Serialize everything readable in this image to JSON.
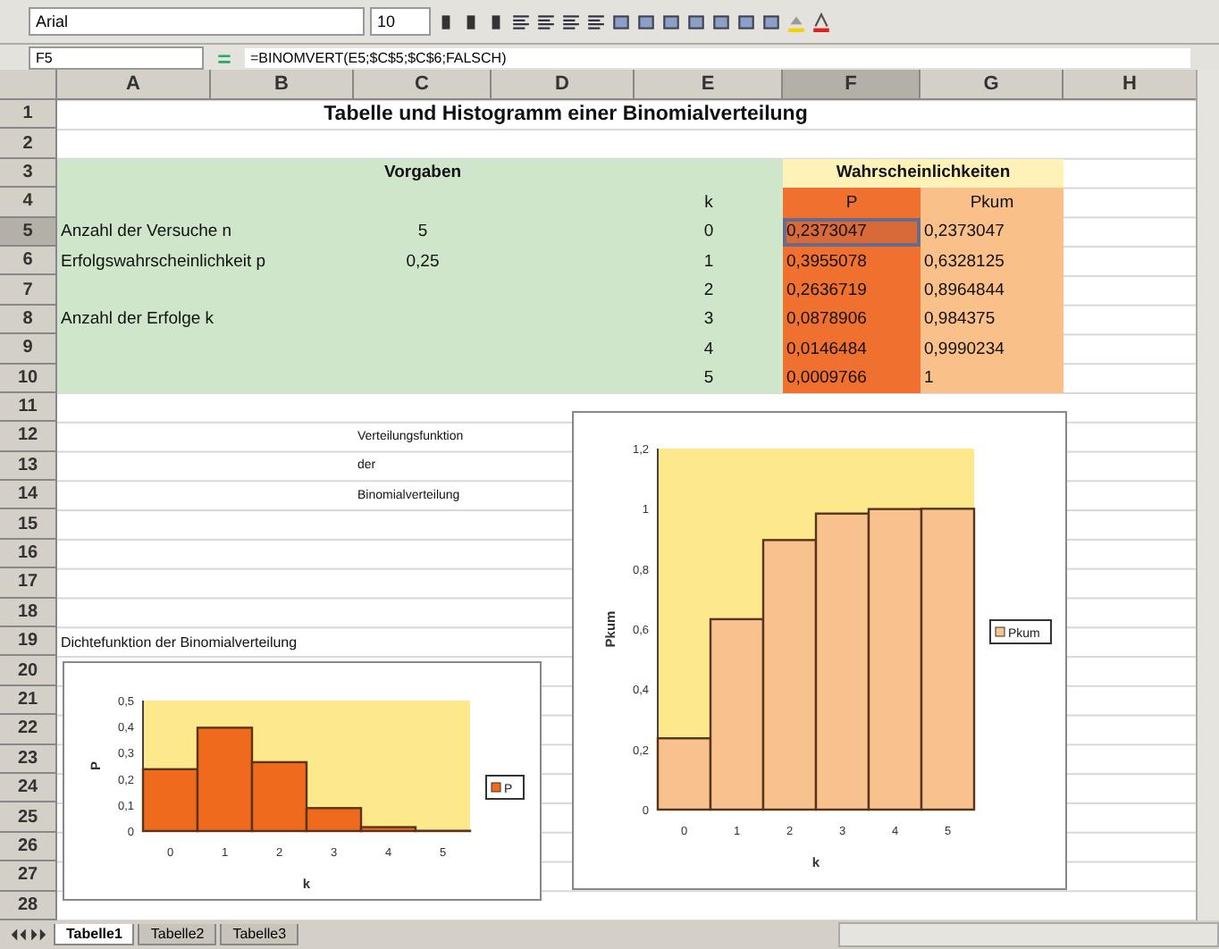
{
  "toolbar": {
    "font": "Arial",
    "size": "10"
  },
  "formula_bar": {
    "name_box": "F5",
    "formula": "=BINOMVERT(E5;$C$5;$C$6;FALSCH)"
  },
  "columns": [
    "A",
    "B",
    "C",
    "D",
    "E",
    "F",
    "G",
    "H"
  ],
  "rows": [
    "1",
    "2",
    "3",
    "4",
    "5",
    "6",
    "7",
    "8",
    "9",
    "10",
    "11",
    "12",
    "13",
    "14",
    "15",
    "16",
    "17",
    "18",
    "19",
    "20",
    "21",
    "22",
    "23",
    "24",
    "25",
    "26",
    "27",
    "28"
  ],
  "title": "Tabelle und Histogramm einer Binomialverteilung",
  "inputs": {
    "heading": "Vorgaben",
    "params": [
      {
        "label": "Anzahl der Versuche n",
        "value": "5"
      },
      {
        "label": "Erfolgswahrscheinlichkeit p",
        "value": "0,25"
      },
      {
        "label": "Anzahl der Erfolge k"
      }
    ]
  },
  "probabilities": {
    "heading": "Wahrscheinlichkeiten",
    "k_header": "k",
    "p_header": "P",
    "pkum_header": "Pkum",
    "rows": [
      {
        "k": "0",
        "p": "0,2373047",
        "pkum": "0,2373047",
        "selected": true
      },
      {
        "k": "1",
        "p": "0,3955078",
        "pkum": "0,6328125",
        "selected": false
      },
      {
        "k": "2",
        "p": "0,2636719",
        "pkum": "0,8964844",
        "selected": false
      },
      {
        "k": "3",
        "p": "0,0878906",
        "pkum": "0,984375",
        "selected": false
      },
      {
        "k": "4",
        "p": "0,0146484",
        "pkum": "0,9990234",
        "selected": false
      },
      {
        "k": "5",
        "p": "0,0009766",
        "pkum": "1",
        "selected": false
      }
    ]
  },
  "notes": [
    {
      "kind": "cdf",
      "lines": [
        "Verteilungsfunktion",
        "der",
        "Binomialverteilung"
      ]
    },
    {
      "kind": "pdf",
      "lines": [
        "Dichtefunktion der Binomialverteilung"
      ]
    }
  ],
  "charts": [
    {
      "chart_data": {
        "type": "bar",
        "xlabel": "k",
        "ylabel": "P",
        "categories": [
          "0",
          "1",
          "2",
          "3",
          "4",
          "5"
        ],
        "series": [
          {
            "name": "P",
            "color": "#f06a1e",
            "values": [
              0.237,
              0.396,
              0.264,
              0.088,
              0.015,
              0.001
            ]
          }
        ],
        "ylim": [
          0,
          0.5
        ],
        "yticks": [
          0,
          {
            "value": 0.1,
            "label": "0,1"
          },
          {
            "value": 0.2,
            "label": "0,2"
          },
          {
            "value": 0.3,
            "label": "0,3"
          },
          {
            "value": 0.4,
            "label": "0,4"
          },
          {
            "value": 0.5,
            "label": "0,5"
          }
        ]
      }
    },
    {
      "chart_data": {
        "type": "bar",
        "xlabel": "k",
        "ylabel": "Pkum",
        "categories": [
          "0",
          "1",
          "2",
          "3",
          "4",
          "5"
        ],
        "series": [
          {
            "name": "Pkum",
            "color": "#f8c28e",
            "values": [
              0.237,
              0.633,
              0.896,
              0.984,
              0.999,
              1
            ]
          }
        ],
        "ylim": [
          0,
          1.2
        ],
        "yticks": [
          0,
          {
            "value": 0.2,
            "label": "0,2"
          },
          {
            "value": 0.4,
            "label": "0,4"
          },
          {
            "value": 0.6,
            "label": "0,6"
          },
          {
            "value": 0.8,
            "label": "0,8"
          },
          {
            "value": 1,
            "label": "1"
          },
          {
            "value": 1.2,
            "label": "1,2"
          }
        ]
      }
    }
  ],
  "sheet_tabs": [
    {
      "label": "Tabelle1",
      "selected": true
    },
    {
      "label": "Tabelle2",
      "selected": false
    },
    {
      "label": "Tabelle3",
      "selected": false
    }
  ]
}
